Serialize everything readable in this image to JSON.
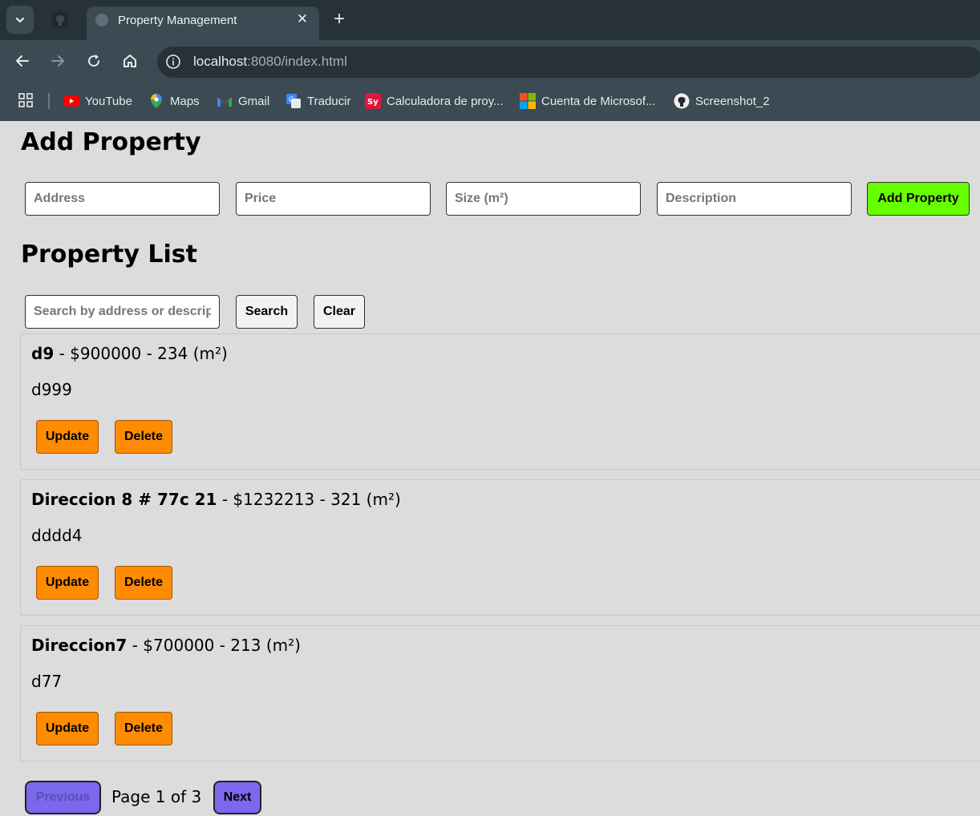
{
  "browser": {
    "tab": {
      "title": "Property Management"
    },
    "address_bar": {
      "host": "localhost",
      "rest": ":8080/index.html"
    },
    "bookmarks": [
      {
        "label": "YouTube",
        "icon": "youtube-icon"
      },
      {
        "label": "Maps",
        "icon": "maps-icon"
      },
      {
        "label": "Gmail",
        "icon": "gmail-icon"
      },
      {
        "label": "Traducir",
        "icon": "translate-icon"
      },
      {
        "label": "Calculadora de proy...",
        "icon": "sy-icon"
      },
      {
        "label": "Cuenta de Microsof...",
        "icon": "microsoft-icon"
      },
      {
        "label": "Screenshot_2",
        "icon": "github-icon"
      }
    ]
  },
  "add_section": {
    "heading": "Add Property",
    "placeholders": {
      "address": "Address",
      "price": "Price",
      "size": "Size (m²)",
      "description": "Description"
    },
    "submit_label": "Add Property"
  },
  "list_section": {
    "heading": "Property List",
    "search_placeholder": "Search by address or description",
    "search_label": "Search",
    "clear_label": "Clear",
    "properties": [
      {
        "address": "d9",
        "details": " - $900000 - 234 (m²)",
        "description": "d999",
        "update_label": "Update",
        "delete_label": "Delete"
      },
      {
        "address": "Direccion 8 # 77c 21",
        "details": " - $1232213 - 321 (m²)",
        "description": "dddd4",
        "update_label": "Update",
        "delete_label": "Delete"
      },
      {
        "address": "Direccion7",
        "details": " - $700000 - 213 (m²)",
        "description": "d77",
        "update_label": "Update",
        "delete_label": "Delete"
      }
    ]
  },
  "pagination": {
    "previous_label": "Previous",
    "page_info": "Page 1 of 3",
    "next_label": "Next"
  },
  "colors": {
    "add_button": "#66ff00",
    "action_button": "#ff8c00",
    "pagination_button": "#7b68ee",
    "page_background": "#dcdcdc"
  }
}
